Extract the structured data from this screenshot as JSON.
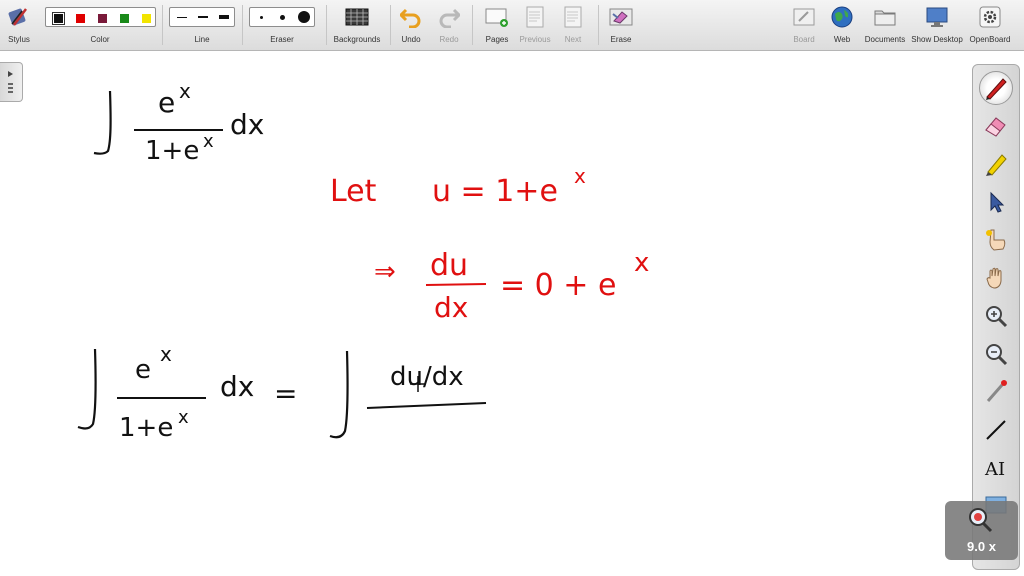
{
  "toolbar": {
    "stylus": "Stylus",
    "color": "Color",
    "line": "Line",
    "eraser": "Eraser",
    "backgrounds": "Backgrounds",
    "undo": "Undo",
    "redo": "Redo",
    "pages": "Pages",
    "previous": "Previous",
    "next": "Next",
    "erase": "Erase",
    "board": "Board",
    "web": "Web",
    "documents": "Documents",
    "show_desktop": "Show Desktop",
    "openboard": "OpenBoard"
  },
  "colors": {
    "swatches": [
      "#111111",
      "#e00000",
      "#7a1a3a",
      "#1a8a1a",
      "#f2e400"
    ],
    "ink_black": "#111111",
    "ink_red": "#e01010"
  },
  "palette_tools": [
    "pen-icon",
    "eraser-icon",
    "highlighter-icon",
    "pointer-icon",
    "laser-pointer-icon",
    "hand-icon",
    "zoom-in-icon",
    "zoom-out-icon",
    "capture-icon",
    "line-icon",
    "text-icon",
    "screen-capture-icon"
  ],
  "zoom": {
    "level": "9.0 x"
  },
  "board": {
    "line1": {
      "integrand_num": "e",
      "exp": "x",
      "denominator": "1+e",
      "differential": "dx"
    },
    "line2": {
      "let": "Let",
      "equation": "u = 1+e",
      "exp": "x"
    },
    "line3": {
      "implies": "⇒",
      "num": "du",
      "den": "dx",
      "rhs": "= 0 + e",
      "exp": "x"
    },
    "line4": {
      "num": "e",
      "exp": "x",
      "den": "1+e",
      "differential": "dx",
      "equals": "=",
      "rhs_num": "du/dx"
    }
  }
}
